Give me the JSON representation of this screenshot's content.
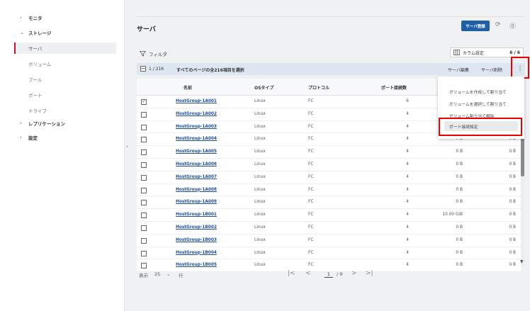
{
  "sidebar": {
    "monitor": "モニタ",
    "storage": "ストレージ",
    "storage_items": [
      "サーバ",
      "ボリューム",
      "プール",
      "ポート",
      "ドライブ"
    ],
    "replication": "レプリケーション",
    "settings": "設定"
  },
  "header": {
    "title": "サーバ",
    "register_button": "サーバ登録"
  },
  "toolbar": {
    "filter": "フィルタ",
    "column_settings": "カラム設定",
    "column_count": "6 / 6"
  },
  "selection_bar": {
    "count": "1 / 216",
    "select_all": "すべてのページの全216項目を選択",
    "edit": "サーバ編集",
    "delete": "サーバ削除"
  },
  "table": {
    "columns": [
      "名前",
      "OSタイプ",
      "プロトコル",
      "ポート接続数"
    ],
    "rows": [
      {
        "checked": true,
        "name": "HostGroup-1A001",
        "os": "Linux",
        "protocol": "FC",
        "ports": "6",
        "cap1": "",
        "cap2": ""
      },
      {
        "checked": false,
        "name": "HostGroup-1A002",
        "os": "Linux",
        "protocol": "FC",
        "ports": "4",
        "cap1": "",
        "cap2": ""
      },
      {
        "checked": false,
        "name": "HostGroup-1A003",
        "os": "Linux",
        "protocol": "FC",
        "ports": "4",
        "cap1": "",
        "cap2": ""
      },
      {
        "checked": false,
        "name": "HostGroup-1A004",
        "os": "Linux",
        "protocol": "FC",
        "ports": "4",
        "cap1": "0 B",
        "cap2": "0 B"
      },
      {
        "checked": false,
        "name": "HostGroup-1A005",
        "os": "Linux",
        "protocol": "FC",
        "ports": "4",
        "cap1": "0 B",
        "cap2": "0 B"
      },
      {
        "checked": false,
        "name": "HostGroup-1A006",
        "os": "Linux",
        "protocol": "FC",
        "ports": "4",
        "cap1": "0 B",
        "cap2": "0 B"
      },
      {
        "checked": false,
        "name": "HostGroup-1A007",
        "os": "Linux",
        "protocol": "FC",
        "ports": "4",
        "cap1": "0 B",
        "cap2": "0 B"
      },
      {
        "checked": false,
        "name": "HostGroup-1A008",
        "os": "Linux",
        "protocol": "FC",
        "ports": "4",
        "cap1": "0 B",
        "cap2": "0 B"
      },
      {
        "checked": false,
        "name": "HostGroup-1A009",
        "os": "Linux",
        "protocol": "FC",
        "ports": "4",
        "cap1": "0 B",
        "cap2": "0 B"
      },
      {
        "checked": false,
        "name": "HostGroup-1B001",
        "os": "Linux",
        "protocol": "FC",
        "ports": "4",
        "cap1": "10.00 GiB",
        "cap2": "0 B"
      },
      {
        "checked": false,
        "name": "HostGroup-1B002",
        "os": "Linux",
        "protocol": "FC",
        "ports": "4",
        "cap1": "0 B",
        "cap2": "0 B"
      },
      {
        "checked": false,
        "name": "HostGroup-1B003",
        "os": "Linux",
        "protocol": "FC",
        "ports": "4",
        "cap1": "0 B",
        "cap2": "0 B"
      },
      {
        "checked": false,
        "name": "HostGroup-1B004",
        "os": "Linux",
        "protocol": "FC",
        "ports": "4",
        "cap1": "0 B",
        "cap2": "0 B"
      },
      {
        "checked": false,
        "name": "HostGroup-1B005",
        "os": "Linux",
        "protocol": "FC",
        "ports": "4",
        "cap1": "0 B",
        "cap2": "0 B"
      }
    ]
  },
  "dropdown": {
    "items": [
      "ボリュームを作成して割り当て",
      "ボリュームを選択して割り当て",
      "ボリューム割り当て解除",
      "ポート接続設定"
    ]
  },
  "pagination": {
    "show_label": "表示",
    "per_page": "25",
    "rows_label": "行",
    "current_page": "1",
    "total_pages": "/ 9"
  },
  "colors": {
    "accent": "#1f5fa8",
    "highlight": "#ee0000",
    "active_marker": "#c8102e"
  }
}
